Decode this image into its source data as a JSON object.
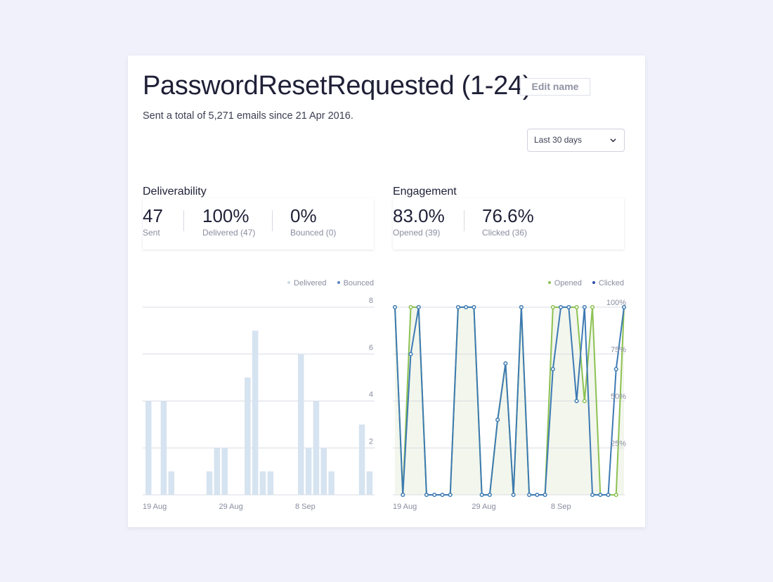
{
  "header": {
    "title": "PasswordResetRequested (1-24)",
    "edit_label": "Edit name",
    "subtitle": "Sent a total of 5,271 emails since 21 Apr 2016."
  },
  "range_select": {
    "value": "Last 30 days"
  },
  "deliverability": {
    "title": "Deliverability",
    "stats": [
      {
        "value": "47",
        "label": "Sent"
      },
      {
        "value": "100%",
        "label": "Delivered (47)"
      },
      {
        "value": "0%",
        "label": "Bounced (0)"
      }
    ]
  },
  "engagement": {
    "title": "Engagement",
    "stats": [
      {
        "value": "83.0%",
        "label": "Opened (39)"
      },
      {
        "value": "76.6%",
        "label": "Clicked (36)"
      }
    ]
  },
  "colors": {
    "delivered": "#d6e3f0",
    "bounced": "#5b84c4",
    "opened": "#8cc152",
    "clicked": "#3d7ab3",
    "opened_fill": "#f2f6ec",
    "grid": "#d9dce4"
  },
  "chart_data": [
    {
      "type": "bar",
      "categories": [
        "19 Aug",
        "20 Aug",
        "21 Aug",
        "22 Aug",
        "23 Aug",
        "24 Aug",
        "25 Aug",
        "26 Aug",
        "27 Aug",
        "28 Aug",
        "29 Aug",
        "30 Aug",
        "31 Aug",
        "1 Sep",
        "2 Sep",
        "3 Sep",
        "4 Sep",
        "5 Sep",
        "6 Sep",
        "7 Sep",
        "8 Sep",
        "9 Sep",
        "10 Sep",
        "11 Sep",
        "12 Sep",
        "13 Sep",
        "14 Sep",
        "15 Sep",
        "16 Sep",
        "17 Sep"
      ],
      "x_tick_labels": [
        "19 Aug",
        "29 Aug",
        "8 Sep"
      ],
      "y_ticks": [
        2,
        4,
        6,
        8
      ],
      "ylim": [
        0,
        8
      ],
      "series": [
        {
          "name": "Delivered",
          "values": [
            4,
            0,
            4,
            1,
            0,
            0,
            0,
            0,
            1,
            2,
            2,
            0,
            0,
            5,
            7,
            1,
            1,
            0,
            0,
            0,
            6,
            2,
            4,
            2,
            1,
            0,
            0,
            0,
            3,
            1
          ]
        },
        {
          "name": "Bounced",
          "values": [
            0,
            0,
            0,
            0,
            0,
            0,
            0,
            0,
            0,
            0,
            0,
            0,
            0,
            0,
            0,
            0,
            0,
            0,
            0,
            0,
            0,
            0,
            0,
            0,
            0,
            0,
            0,
            0,
            0,
            0
          ]
        }
      ],
      "legend": [
        "Delivered",
        "Bounced"
      ],
      "legend_position": "top-right",
      "grid": true
    },
    {
      "type": "line",
      "categories": [
        "19 Aug",
        "20 Aug",
        "21 Aug",
        "22 Aug",
        "23 Aug",
        "24 Aug",
        "25 Aug",
        "26 Aug",
        "27 Aug",
        "28 Aug",
        "29 Aug",
        "30 Aug",
        "31 Aug",
        "1 Sep",
        "2 Sep",
        "3 Sep",
        "4 Sep",
        "5 Sep",
        "6 Sep",
        "7 Sep",
        "8 Sep",
        "9 Sep",
        "10 Sep",
        "11 Sep",
        "12 Sep",
        "13 Sep",
        "14 Sep",
        "15 Sep",
        "16 Sep",
        "17 Sep"
      ],
      "x_tick_labels": [
        "19 Aug",
        "29 Aug",
        "8 Sep"
      ],
      "y_ticks": [
        "25%",
        "50%",
        "75%",
        "100%"
      ],
      "ylim": [
        0,
        100
      ],
      "series": [
        {
          "name": "Opened",
          "values": [
            100,
            0,
            100,
            100,
            0,
            0,
            0,
            0,
            100,
            100,
            100,
            0,
            0,
            40,
            70,
            0,
            100,
            0,
            0,
            0,
            100,
            100,
            100,
            100,
            50,
            100,
            0,
            0,
            0,
            100
          ]
        },
        {
          "name": "Clicked",
          "values": [
            100,
            0,
            75,
            100,
            0,
            0,
            0,
            0,
            100,
            100,
            100,
            0,
            0,
            40,
            70,
            0,
            100,
            0,
            0,
            0,
            67,
            100,
            100,
            50,
            100,
            0,
            0,
            0,
            67,
            100
          ]
        }
      ],
      "legend": [
        "Opened",
        "Clicked"
      ],
      "legend_position": "top-right",
      "grid": true
    }
  ]
}
